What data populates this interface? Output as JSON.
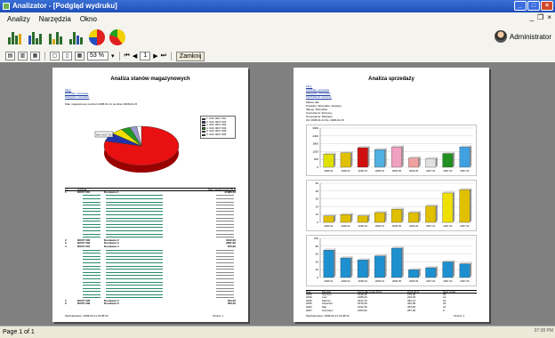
{
  "window": {
    "title": "Analizator - [Podgląd wydruku]",
    "minimize": "_",
    "maximize": "□",
    "close": "×"
  },
  "menu": {
    "items": [
      "Analizy",
      "Narzędzia",
      "Okno"
    ],
    "mdi_min": "_",
    "mdi_restore": "❐",
    "mdi_close": "×"
  },
  "user": {
    "name": "Administrator"
  },
  "toolbar_print": {
    "zoom": "53 %",
    "page": "1",
    "close_label": "Zamknij"
  },
  "status": {
    "page_info": "Page 1 of 1",
    "corner": "07:38 PM"
  },
  "page1": {
    "title": "Analiza stanów magazynowych",
    "links": [
      "Filtry:",
      "Oddziały: wszystkie",
      "Kategorie: wszystkie"
    ],
    "subtitle": "Stan magazynowy na dzień 2008-01-31 na dzień 2008-02-15",
    "pie_legend": [
      "1. 6AK 0027 001",
      "2. 6AK 0027 002",
      "3. 6AK 0027 003",
      "4. 6AK 0027 004",
      "5. 6AK 0027 005",
      "6. 6AK 0027 006"
    ],
    "pie_label": "6AK 0027 001",
    "table_header": [
      "Lp.",
      "Oddział",
      "Stan magazynowy PLN"
    ],
    "groups": [
      {
        "lp": "1",
        "code": "DOST 001",
        "name": "Dostawca 1",
        "value": "21686,50"
      },
      {
        "lp": "2",
        "code": "DOST 002",
        "name": "Dostawca 2",
        "value": "3042,00"
      },
      {
        "lp": "3",
        "code": "DOST 003",
        "name": "Dostawca 3",
        "value": "2897,60"
      },
      {
        "lp": "4",
        "code": "DOST 004",
        "name": "Dostawca 4",
        "value": "875,60"
      },
      {
        "lp": "5",
        "code": "DOST 005",
        "name": "Dostawca 5",
        "value": "624,00"
      },
      {
        "lp": "6",
        "code": "DOST 006",
        "name": "Dostawca 6",
        "value": "356,20"
      }
    ],
    "footer_left": "Wydrukowano: 2008-02-21 19:38:33",
    "footer_right": "Strona: 1"
  },
  "page2": {
    "title": "Analiza sprzedaży",
    "links": [
      "Filtry:",
      "Oddziały: wszystkie",
      "Kategorie: wszystkie",
      "Kontrahenci: wszyscy"
    ],
    "notes": [
      "Zakres dat:",
      "Produkty: Wszystkie, Zestawy",
      "Sklepy: Wszystkie",
      "Kontrahenci: Wszyscy",
      "Grupowanie: Miesiące",
      "Od: 2008-01-01 Do: 2008-02-15"
    ],
    "bottom_table_header": [
      "Rok",
      "Miesiąc",
      "Sprzedaż netto PLN",
      "Zysk PLN",
      "Ilość sztuk"
    ],
    "bottom_rows": [
      [
        "2006",
        "Styczeń",
        "1548,45",
        "279,40",
        "26"
      ],
      [
        "2006",
        "Luty",
        "1485,64",
        "229,63",
        "12"
      ],
      [
        "2006",
        "Marzec",
        "2012,70",
        "392,14",
        "16"
      ],
      [
        "2006",
        "Kwiecień",
        "1879,45",
        "402,06",
        "23"
      ],
      [
        "2006",
        "Maj",
        "2162,45",
        "354,66",
        "21"
      ],
      [
        "2007",
        "Czerwiec",
        "1053,60",
        "287,40",
        "6"
      ]
    ],
    "footer_left": "Wydrukowano: 2008-02-21 19:38:33",
    "footer_right": "Strona: 1"
  },
  "chart_data": [
    {
      "type": "pie",
      "title": "",
      "values": [
        79,
        7,
        5,
        4,
        3,
        2
      ],
      "colors": [
        "#e81010",
        "#2233aa",
        "#f0e000",
        "#229922",
        "#9999cc",
        "#ffffff"
      ]
    },
    {
      "type": "bar",
      "title": "",
      "categories": [
        "2006 01",
        "2006 02",
        "2006 03",
        "2006 04",
        "2006 05",
        "2006 06",
        "2007 01",
        "2007 02",
        "2007 03"
      ],
      "values": [
        1000,
        1100,
        1500,
        1350,
        1550,
        700,
        650,
        1050,
        1550
      ],
      "colors": [
        "#e0e000",
        "#e0c000",
        "#d01010",
        "#50b0e0",
        "#f0a0c0",
        "#f0a0a0",
        "#e0e0e0",
        "#209020",
        "#40a0e0"
      ],
      "ylim": [
        0,
        3000
      ]
    },
    {
      "type": "bar",
      "title": "",
      "categories": [
        "2006 01",
        "2006 02",
        "2006 03",
        "2006 04",
        "2006 05",
        "2006 06",
        "2007 01",
        "2007 02",
        "2007 03"
      ],
      "values": [
        10,
        12,
        10,
        15,
        20,
        15,
        25,
        45,
        50
      ],
      "colors": [
        "#e0c000",
        "#e0c000",
        "#e0c000",
        "#e0c000",
        "#e0c000",
        "#e0c000",
        "#e0c000",
        "#f0e000",
        "#e0c000"
      ],
      "ylim": [
        0,
        60
      ]
    },
    {
      "type": "bar",
      "title": "",
      "categories": [
        "2006 01",
        "2006 02",
        "2006 03",
        "2006 04",
        "2006 05",
        "2006 06",
        "2007 01",
        "2007 02",
        "2007 03"
      ],
      "values": [
        70,
        50,
        45,
        55,
        75,
        20,
        25,
        40,
        35
      ],
      "colors": [
        "#1e90d0",
        "#1e90d0",
        "#1e90d0",
        "#1e90d0",
        "#1e90d0",
        "#1e90d0",
        "#1e90d0",
        "#1e90d0",
        "#1e90d0"
      ],
      "ylim": [
        0,
        100
      ]
    }
  ]
}
